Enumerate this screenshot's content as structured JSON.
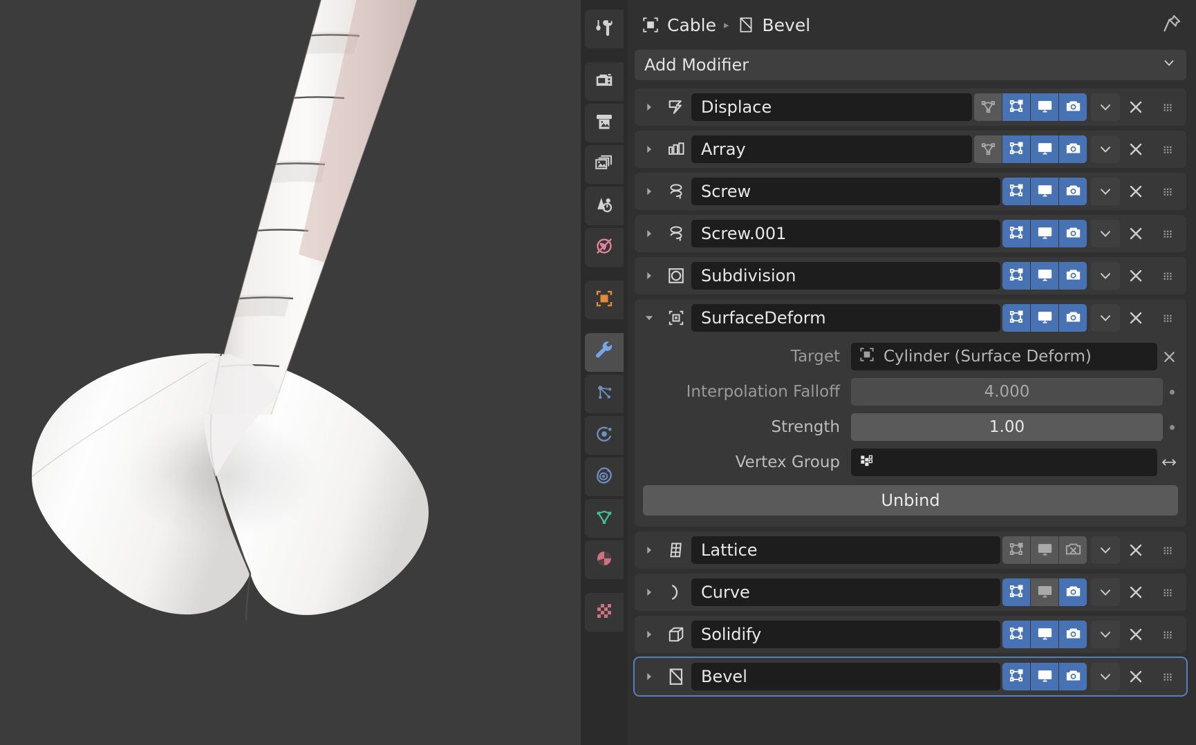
{
  "breadcrumb": {
    "object_label": "Cable",
    "object_icon": "object-data-icon",
    "separator": "▸",
    "modifier_label": "Bevel",
    "modifier_icon": "bevel-icon",
    "pin_icon": "pin-icon"
  },
  "tabs": [
    {
      "name": "tool",
      "icon": "tool-icon",
      "active": false,
      "color": "#d2d2d2",
      "gap": true
    },
    {
      "name": "render",
      "icon": "render-camera-icon",
      "active": false,
      "color": "#d2d2d2",
      "gap": false
    },
    {
      "name": "output",
      "icon": "output-printer-icon",
      "active": false,
      "color": "#d2d2d2",
      "gap": false
    },
    {
      "name": "view-layer",
      "icon": "view-layer-icon",
      "active": false,
      "color": "#d2d2d2",
      "gap": false
    },
    {
      "name": "scene",
      "icon": "scene-icon",
      "active": false,
      "color": "#d2d2d2",
      "gap": false
    },
    {
      "name": "world",
      "icon": "world-globe-icon",
      "active": false,
      "color": "#e0849a",
      "gap": true
    },
    {
      "name": "object",
      "icon": "object-square-icon",
      "active": false,
      "color": "#e08b3c",
      "gap": true
    },
    {
      "name": "modifiers",
      "icon": "wrench-icon",
      "active": true,
      "color": "#76a5e8",
      "gap": false
    },
    {
      "name": "particles",
      "icon": "particles-icon",
      "active": false,
      "color": "#6e8fc0",
      "gap": false
    },
    {
      "name": "physics",
      "icon": "physics-icon",
      "active": false,
      "color": "#6e8fc0",
      "gap": false
    },
    {
      "name": "constraints",
      "icon": "constraints-icon",
      "active": false,
      "color": "#6e8fc0",
      "gap": false
    },
    {
      "name": "object-data",
      "icon": "mesh-data-icon",
      "active": false,
      "color": "#3fc19a",
      "gap": false
    },
    {
      "name": "material",
      "icon": "material-sphere-icon",
      "active": false,
      "color": "#d0717f",
      "gap": true
    },
    {
      "name": "texture",
      "icon": "texture-checker-icon",
      "active": false,
      "color": "#d0717f",
      "gap": false
    }
  ],
  "add_modifier": {
    "label": "Add Modifier",
    "chevron_icon": "chevron-down-icon"
  },
  "colors": {
    "toggle_on": "#4772b3",
    "toggle_off": "#585858",
    "active_outline": "#5680c2",
    "panel_bg": "#303030",
    "row_bg": "#383838",
    "field_bg": "#1d1d1d",
    "viewport_bg": "#3c3c3c"
  },
  "modifiers": [
    {
      "name": "Displace",
      "icon": "displace-icon",
      "expanded": false,
      "active": false,
      "toggles": [
        {
          "name": "on-cage",
          "icon": "vertex-cage-icon",
          "on": false,
          "shown": true
        },
        {
          "name": "edit-mode",
          "icon": "edit-mode-icon",
          "on": true,
          "shown": true
        },
        {
          "name": "realtime",
          "icon": "display-icon",
          "on": true,
          "shown": true
        },
        {
          "name": "render",
          "icon": "render-icon",
          "on": true,
          "shown": true
        }
      ]
    },
    {
      "name": "Array",
      "icon": "array-icon",
      "expanded": false,
      "active": false,
      "toggles": [
        {
          "name": "on-cage",
          "icon": "vertex-cage-icon",
          "on": false,
          "shown": true
        },
        {
          "name": "edit-mode",
          "icon": "edit-mode-icon",
          "on": true,
          "shown": true
        },
        {
          "name": "realtime",
          "icon": "display-icon",
          "on": true,
          "shown": true
        },
        {
          "name": "render",
          "icon": "render-icon",
          "on": true,
          "shown": true
        }
      ]
    },
    {
      "name": "Screw",
      "icon": "screw-icon",
      "expanded": false,
      "active": false,
      "toggles": [
        {
          "name": "edit-mode",
          "icon": "edit-mode-icon",
          "on": true,
          "shown": true
        },
        {
          "name": "realtime",
          "icon": "display-icon",
          "on": true,
          "shown": true
        },
        {
          "name": "render",
          "icon": "render-icon",
          "on": true,
          "shown": true
        }
      ]
    },
    {
      "name": "Screw.001",
      "icon": "screw-icon",
      "expanded": false,
      "active": false,
      "toggles": [
        {
          "name": "edit-mode",
          "icon": "edit-mode-icon",
          "on": true,
          "shown": true
        },
        {
          "name": "realtime",
          "icon": "display-icon",
          "on": true,
          "shown": true
        },
        {
          "name": "render",
          "icon": "render-icon",
          "on": true,
          "shown": true
        }
      ]
    },
    {
      "name": "Subdivision",
      "icon": "subdivision-icon",
      "expanded": false,
      "active": false,
      "toggles": [
        {
          "name": "edit-mode",
          "icon": "edit-mode-icon",
          "on": true,
          "shown": true
        },
        {
          "name": "realtime",
          "icon": "display-icon",
          "on": true,
          "shown": true
        },
        {
          "name": "render",
          "icon": "render-icon",
          "on": true,
          "shown": true
        }
      ]
    },
    {
      "name": "SurfaceDeform",
      "icon": "surface-deform-icon",
      "expanded": true,
      "active": false,
      "toggles": [
        {
          "name": "edit-mode",
          "icon": "edit-mode-icon",
          "on": true,
          "shown": true
        },
        {
          "name": "realtime",
          "icon": "display-icon",
          "on": true,
          "shown": true
        },
        {
          "name": "render",
          "icon": "render-icon",
          "on": true,
          "shown": true
        }
      ],
      "body": {
        "target_label": "Target",
        "target_value": "Cylinder (Surface Deform)",
        "target_icon": "object-data-icon",
        "target_clear_icon": "close-icon",
        "falloff_label": "Interpolation Falloff",
        "falloff_value": "4.000",
        "strength_label": "Strength",
        "strength_value": "1.00",
        "vertex_group_label": "Vertex Group",
        "vertex_group_value": "",
        "vertex_group_icon": "vertex-group-icon",
        "vertex_group_invert_icon": "arrows-swap-icon",
        "unbind_label": "Unbind"
      }
    },
    {
      "name": "Lattice",
      "icon": "lattice-icon",
      "expanded": false,
      "active": false,
      "toggles": [
        {
          "name": "edit-mode",
          "icon": "edit-mode-icon",
          "on": false,
          "shown": true
        },
        {
          "name": "realtime",
          "icon": "display-icon",
          "on": false,
          "shown": true
        },
        {
          "name": "render",
          "icon": "render-off-icon",
          "on": false,
          "shown": true
        }
      ]
    },
    {
      "name": "Curve",
      "icon": "curve-icon",
      "expanded": false,
      "active": false,
      "toggles": [
        {
          "name": "edit-mode",
          "icon": "edit-mode-icon",
          "on": true,
          "shown": true
        },
        {
          "name": "realtime",
          "icon": "display-icon",
          "on": false,
          "shown": true
        },
        {
          "name": "render",
          "icon": "render-icon",
          "on": true,
          "shown": true
        }
      ]
    },
    {
      "name": "Solidify",
      "icon": "solidify-icon",
      "expanded": false,
      "active": false,
      "toggles": [
        {
          "name": "edit-mode",
          "icon": "edit-mode-icon",
          "on": true,
          "shown": true
        },
        {
          "name": "realtime",
          "icon": "display-icon",
          "on": true,
          "shown": true
        },
        {
          "name": "render",
          "icon": "render-icon",
          "on": true,
          "shown": true
        }
      ]
    },
    {
      "name": "Bevel",
      "icon": "bevel-icon",
      "expanded": false,
      "active": true,
      "toggles": [
        {
          "name": "edit-mode",
          "icon": "edit-mode-icon",
          "on": true,
          "shown": true
        },
        {
          "name": "realtime",
          "icon": "display-icon",
          "on": true,
          "shown": true
        },
        {
          "name": "render",
          "icon": "render-icon",
          "on": true,
          "shown": true
        }
      ]
    }
  ],
  "row_controls": {
    "expand_collapsed_icon": "triangle-right-icon",
    "expand_expanded_icon": "triangle-down-icon",
    "dropdown_icon": "chevron-down-icon",
    "delete_icon": "close-icon",
    "grip_icon": "grip-dots-icon"
  },
  "viewport": {
    "name": "3d-viewport",
    "description": "Shaded 3D view of a twisted white cable mesh flaring into a conical base"
  }
}
